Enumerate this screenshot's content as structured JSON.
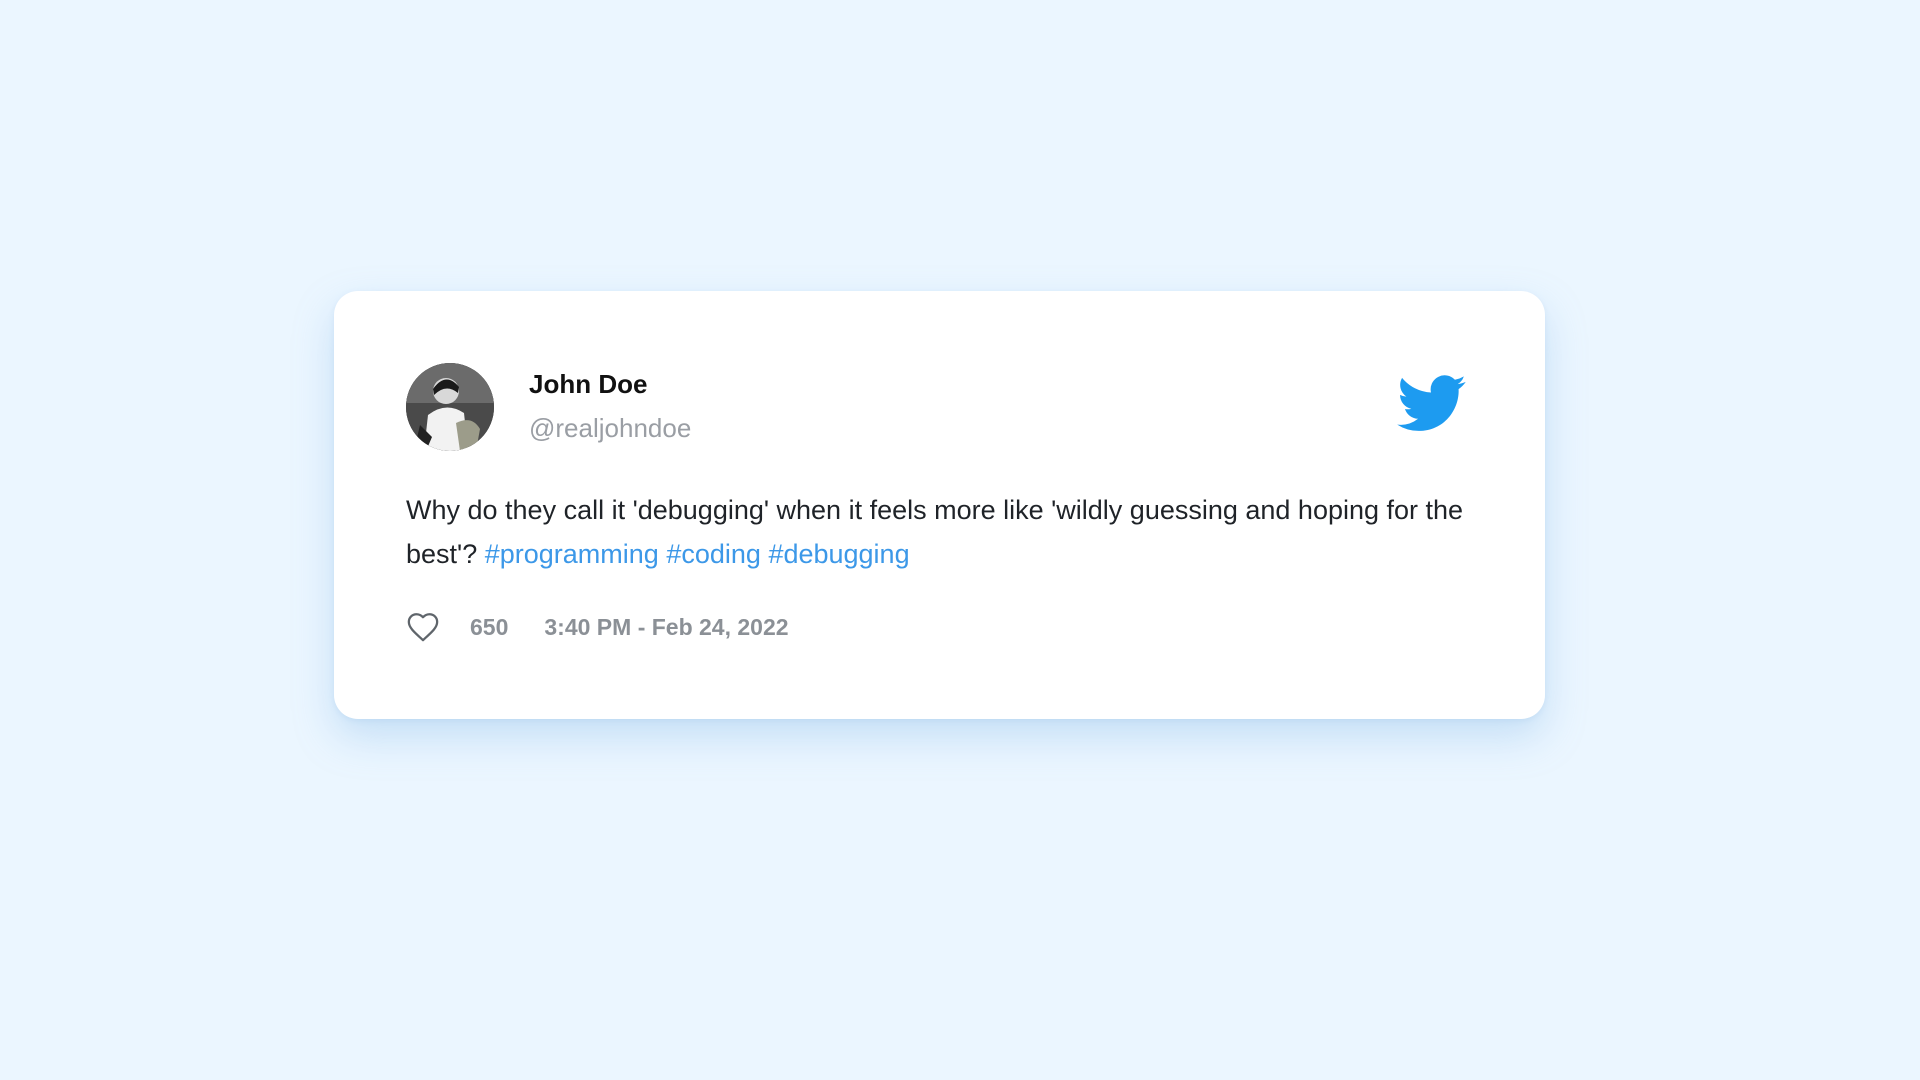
{
  "tweet": {
    "author": {
      "display_name": "John Doe",
      "handle": "@realjohndoe",
      "avatar_icon": "profile-photo"
    },
    "brand_icon": "twitter-bird-icon",
    "body_text": "Why do they call it 'debugging' when it feels more like 'wildly guessing and hoping for the best'?",
    "hashtags": [
      "#programming",
      "#coding",
      "#debugging"
    ],
    "likes": "650",
    "like_icon": "heart-outline-icon",
    "timestamp": "3:40 PM - Feb 24, 2022"
  },
  "colors": {
    "background": "#ebf6ff",
    "card": "#ffffff",
    "hashtag": "#3c98e8",
    "twitter_blue": "#1d9bf0",
    "muted_text": "#8b9096"
  }
}
